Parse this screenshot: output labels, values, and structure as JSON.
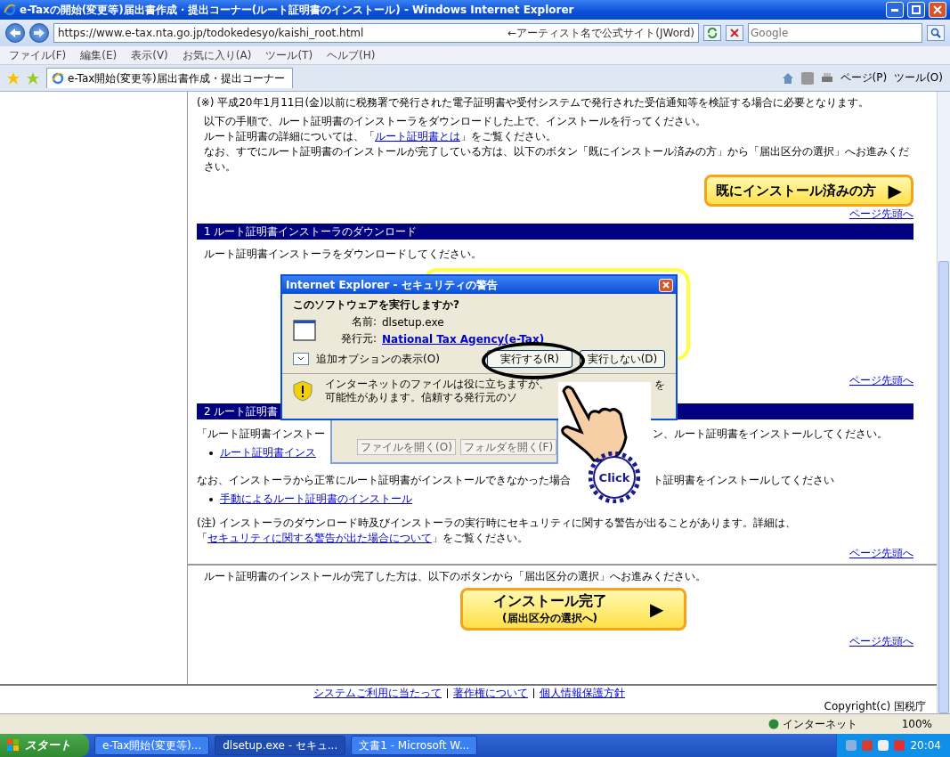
{
  "window": {
    "title": "e-Taxの開始(変更等)届出書作成・提出コーナー(ルート証明書のインストール) - Windows Internet Explorer"
  },
  "address_bar": {
    "url": "https://www.e-tax.nta.go.jp/todokedesyo/kaishi_root.html",
    "hint": "←アーティスト名で公式サイト(JWord)"
  },
  "search": {
    "placeholder": "Google"
  },
  "menu": [
    "ファイル(F)",
    "編集(E)",
    "表示(V)",
    "お気に入り(A)",
    "ツール(T)",
    "ヘルプ(H)"
  ],
  "tab": {
    "label": "e-Tax開始(変更等)届出書作成・提出コーナー"
  },
  "command_bar": [
    "ページ(P)",
    "ツール(O)"
  ],
  "content": {
    "note": "(※) 平成20年1月11日(金)以前に税務署で発行された電子証明書や受付システムで発行された受信通知等を検証する場合に必要となります。",
    "intro": [
      [
        {
          "kind": "text",
          "text": "以下の手順で、ルート証明書のインストーラをダウンロードした上で、インストールを行ってください。"
        }
      ],
      [
        {
          "kind": "text",
          "text": "ルート証明書の詳細については、「"
        },
        {
          "kind": "link",
          "text": "ルート証明書とは"
        },
        {
          "kind": "text",
          "text": "」をご覧ください。"
        }
      ],
      [
        {
          "kind": "text",
          "text": "なお、すでにルート証明書のインストールが完了している方は、以下のボタン「既にインストール済みの方」から「届出区分の選択」へお進みください。"
        }
      ]
    ],
    "installed_button": "既にインストール済みの方",
    "arrow": "▶",
    "page_top": [
      "ページ先頭へ",
      "ページ先頭へ",
      "ページ先頭へ",
      "ページ先頭へ"
    ],
    "section1": {
      "title": "1 ルート証明書インストーラのダウンロード",
      "text": "ルート証明書インストーラをダウンロードしてください。"
    },
    "section2": {
      "title": "2 ルート証明書",
      "text_left": "「ルート証明書インストー",
      "text_right": "ン、ルート証明書をインストールしてください。",
      "link": "ルート証明書インス",
      "fallback_left": "なお、インストーラから正常にルート証明書がインストールできなかった場合",
      "fallback_right": "ト証明書をインストールしてください",
      "manual_link": "手動によるルート証明書のインストール",
      "note": [
        {
          "kind": "text",
          "text": "(注) インストーラのダウンロード時及びインストーラの実行時にセキュリティに関する警告が出ることがあります。詳細は、「"
        },
        {
          "kind": "link",
          "text": "セキュリティに関する警告が出た場合について"
        },
        {
          "kind": "text",
          "text": "」をご覧ください。"
        }
      ]
    },
    "complete_text": "ルート証明書のインストールが完了した方は、以下のボタンから「届出区分の選択」へお進みください。",
    "complete_button": {
      "title": "インストール完了",
      "subtitle": "(届出区分の選択へ)"
    },
    "footer_links": [
      "システムご利用に当たって",
      "著作権について",
      "個人情報保護方針"
    ],
    "copyright": "Copyright(c) 国税庁"
  },
  "dialog": {
    "title": "Internet Explorer - セキュリティの警告",
    "question": "このソフトウェアを実行しますか?",
    "name_label": "名前:",
    "name": "dlsetup.exe",
    "publisher_label": "発行元:",
    "publisher": "National Tax Agency(e-Tax)",
    "options": "追加オプションの表示(O)",
    "buttons": [
      "実行する(R)",
      "実行しない(D)"
    ],
    "warning": [
      "インターネットのファイルは役に立ちますが、",
      "可能性があります。信頼する発行元のソ"
    ],
    "warning_tail": "を"
  },
  "back_dialog": {
    "buttons": [
      "ファイルを開く(O)",
      "フォルダを開く(F)"
    ]
  },
  "click_badge": "Click",
  "status_bar": {
    "zone": "インターネット",
    "zoom": "100%"
  },
  "taskbar": {
    "start": "スタート",
    "items": [
      {
        "label": "e-Tax開始(変更等)...",
        "selected": false
      },
      {
        "label": "dlsetup.exe - セキュ...",
        "selected": true
      },
      {
        "label": "文書1 - Microsoft W...",
        "selected": false
      }
    ],
    "clock": "20:04"
  }
}
